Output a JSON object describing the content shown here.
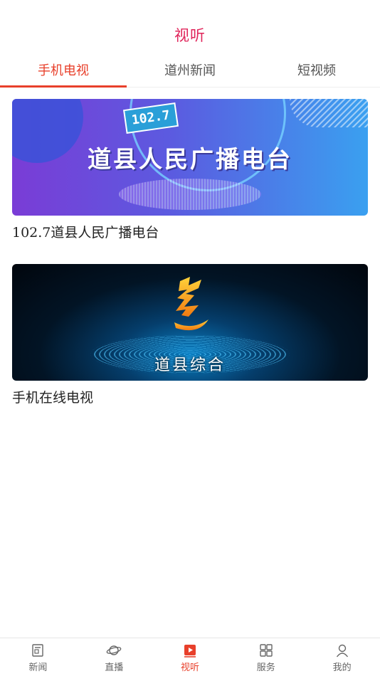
{
  "header": {
    "title": "视听"
  },
  "tabs": [
    {
      "label": "手机电视",
      "active": true
    },
    {
      "label": "道州新闻",
      "active": false
    },
    {
      "label": "短视频",
      "active": false
    }
  ],
  "cards": [
    {
      "badge": "102.7",
      "overlay": "道县人民广播电台",
      "caption": "102.7道县人民广播电台"
    },
    {
      "overlay": "道县综合",
      "caption": "手机在线电视"
    }
  ],
  "bottom_nav": [
    {
      "label": "新闻",
      "icon": "news-icon",
      "active": false
    },
    {
      "label": "直播",
      "icon": "live-icon",
      "active": false
    },
    {
      "label": "视听",
      "icon": "video-icon",
      "active": true
    },
    {
      "label": "服务",
      "icon": "grid-icon",
      "active": false
    },
    {
      "label": "我的",
      "icon": "user-icon",
      "active": false
    }
  ],
  "colors": {
    "accent": "#e8402b",
    "title": "#e0245a"
  }
}
